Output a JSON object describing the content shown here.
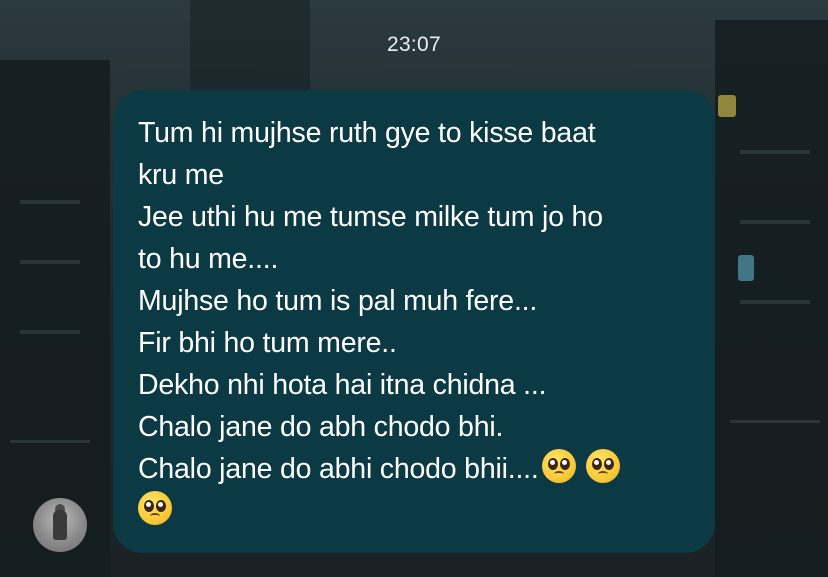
{
  "chat": {
    "timestamp": "23:07",
    "message": {
      "lines": [
        "Tum hi mujhse ruth gye to kisse baat",
        "kru me",
        "Jee uthi hu me tumse milke tum jo ho",
        "to hu me....",
        "Mujhse ho tum is pal muh fere...",
        "Fir bhi ho tum mere..",
        "Dekho nhi hota hai itna chidna ...",
        "Chalo jane do abh chodo bhi.",
        "Chalo jane do abhi chodo bhii...."
      ],
      "emoji": "pleading-face"
    },
    "avatar_icon": "user-avatar"
  }
}
